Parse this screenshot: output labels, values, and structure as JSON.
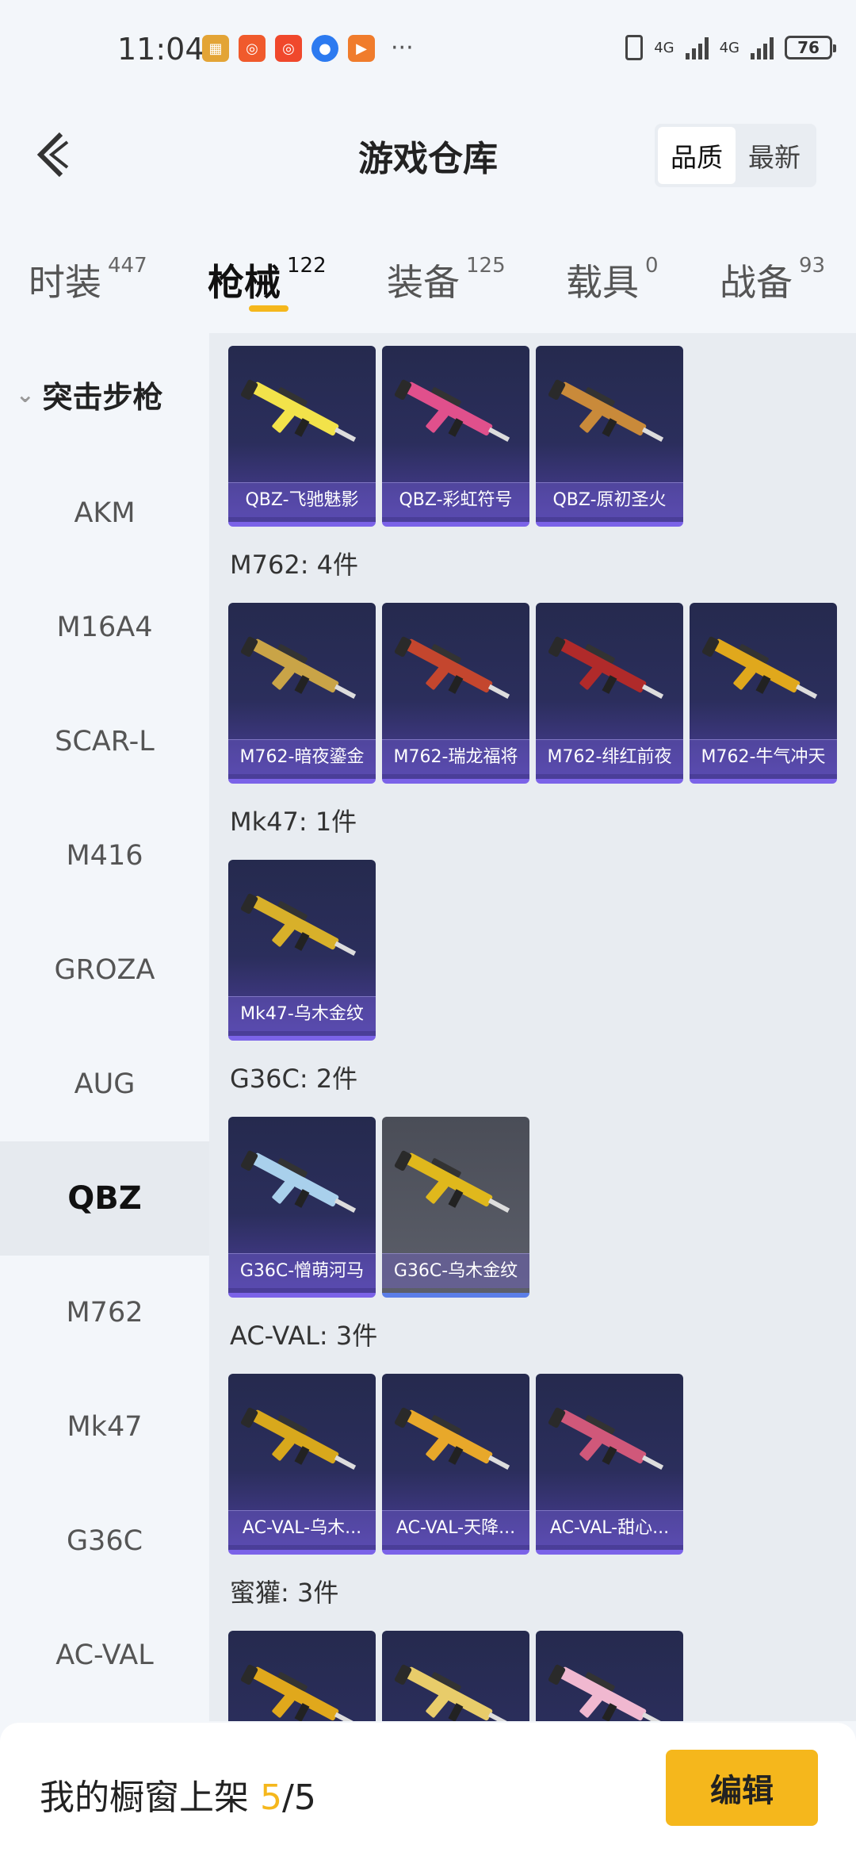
{
  "status": {
    "time": "11:04",
    "battery": "76",
    "network1": "4G",
    "network2": "4G",
    "more": "···"
  },
  "header": {
    "title": "游戏仓库",
    "sort_options": [
      "品质",
      "最新"
    ],
    "sort_active": "品质"
  },
  "tabs": [
    {
      "label": "时装",
      "count": "447"
    },
    {
      "label": "枪械",
      "count": "122"
    },
    {
      "label": "装备",
      "count": "125"
    },
    {
      "label": "载具",
      "count": "0"
    },
    {
      "label": "战备",
      "count": "93"
    }
  ],
  "sidebar": {
    "group": "突击步枪",
    "items": [
      "AKM",
      "M16A4",
      "SCAR-L",
      "M416",
      "GROZA",
      "AUG",
      "QBZ",
      "M762",
      "Mk47",
      "G36C",
      "AC-VAL"
    ],
    "active": "QBZ"
  },
  "sections": [
    {
      "title": "",
      "items": [
        "QBZ-飞驰魅影",
        "QBZ-彩虹符号",
        "QBZ-原初圣火"
      ],
      "colors": [
        "#f2e24a",
        "#e0508c",
        "#c98a3a"
      ]
    },
    {
      "title": "M762: 4件",
      "items": [
        "M762-暗夜鎏金",
        "M762-瑞龙福将",
        "M762-绯红前夜",
        "M762-牛气冲天"
      ],
      "colors": [
        "#c9a447",
        "#c4462e",
        "#b02a2a",
        "#e0a81c"
      ]
    },
    {
      "title": "Mk47: 1件",
      "items": [
        "Mk47-乌木金纹"
      ],
      "colors": [
        "#d8b02a"
      ]
    },
    {
      "title": "G36C: 2件",
      "items": [
        "G36C-憎萌河马",
        "G36C-乌木金纹"
      ],
      "colors": [
        "#a9d0ec",
        "#e0b81c"
      ]
    },
    {
      "title": "AC-VAL: 3件",
      "items": [
        "AC-VAL-乌木...",
        "AC-VAL-天降...",
        "AC-VAL-甜心..."
      ],
      "colors": [
        "#d8a81c",
        "#e8a82a",
        "#d0587a"
      ]
    },
    {
      "title": "蜜獾: 3件",
      "items": [
        "",
        "",
        ""
      ],
      "colors": [
        "#e0a81c",
        "#e8cc6a",
        "#f0b8d0"
      ]
    }
  ],
  "bottom": {
    "label": "我的橱窗上架",
    "current": "5",
    "total": "/5",
    "edit": "编辑"
  }
}
